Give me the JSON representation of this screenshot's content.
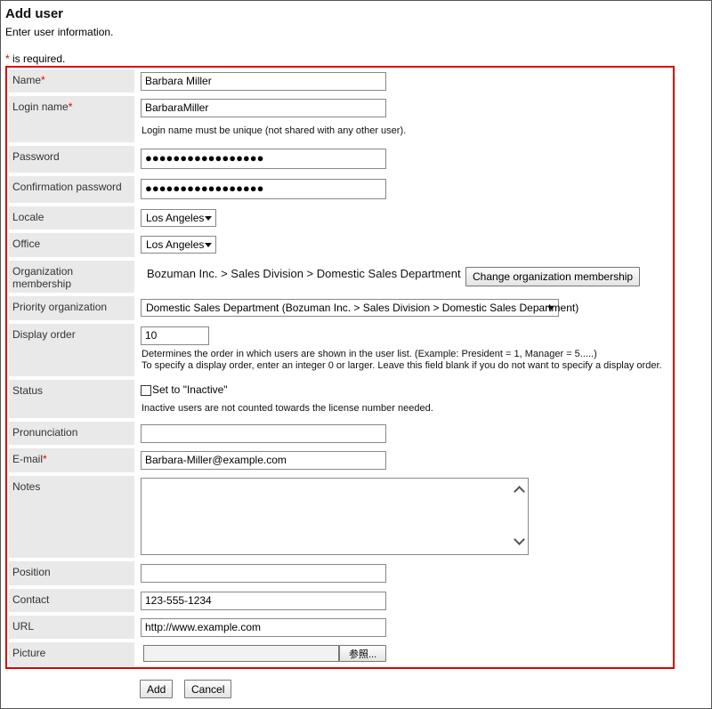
{
  "header": {
    "title": "Add user",
    "subtitle": "Enter user information.",
    "required_mark": "*",
    "required_text": " is required."
  },
  "fields": {
    "name": {
      "label": "Name",
      "value": "Barbara Miller"
    },
    "login_name": {
      "label": "Login name",
      "value": "BarbaraMiller",
      "hint": "Login name must be unique (not shared with any other user)."
    },
    "password": {
      "label": "Password",
      "value": "●●●●●●●●●●●●●●●●●"
    },
    "confirm_password": {
      "label": "Confirmation password",
      "value": "●●●●●●●●●●●●●●●●●"
    },
    "locale": {
      "label": "Locale",
      "value": "Los Angeles"
    },
    "office": {
      "label": "Office",
      "value": "Los Angeles"
    },
    "org_membership": {
      "label": "Organization membership",
      "value": "Bozuman Inc. > Sales Division > Domestic Sales Department",
      "button": "Change organization membership"
    },
    "priority_org": {
      "label": "Priority organization",
      "value": "Domestic Sales Department (Bozuman Inc. > Sales Division > Domestic Sales Department)"
    },
    "display_order": {
      "label": "Display order",
      "value": "10",
      "hint1": "Determines the order in which users are shown in the user list. (Example: President = 1, Manager = 5.....)",
      "hint2": "To specify a display order, enter an integer 0 or larger. Leave this field blank if you do not want to specify a display order."
    },
    "status": {
      "label": "Status",
      "checkbox_label": "Set to \"Inactive\"",
      "hint": "Inactive users are not counted towards the license number needed."
    },
    "pronunciation": {
      "label": "Pronunciation",
      "value": ""
    },
    "email": {
      "label": "E-mail",
      "value": "Barbara-Miller@example.com"
    },
    "notes": {
      "label": "Notes",
      "value": ""
    },
    "position": {
      "label": "Position",
      "value": ""
    },
    "contact": {
      "label": "Contact",
      "value": "123-555-1234"
    },
    "url": {
      "label": "URL",
      "value": "http://www.example.com"
    },
    "picture": {
      "label": "Picture",
      "browse_button": "参照..."
    }
  },
  "actions": {
    "add": "Add",
    "cancel": "Cancel"
  },
  "colors": {
    "required": "#e00000",
    "label_bg": "#e9e9e9",
    "form_border": "#e00000"
  }
}
